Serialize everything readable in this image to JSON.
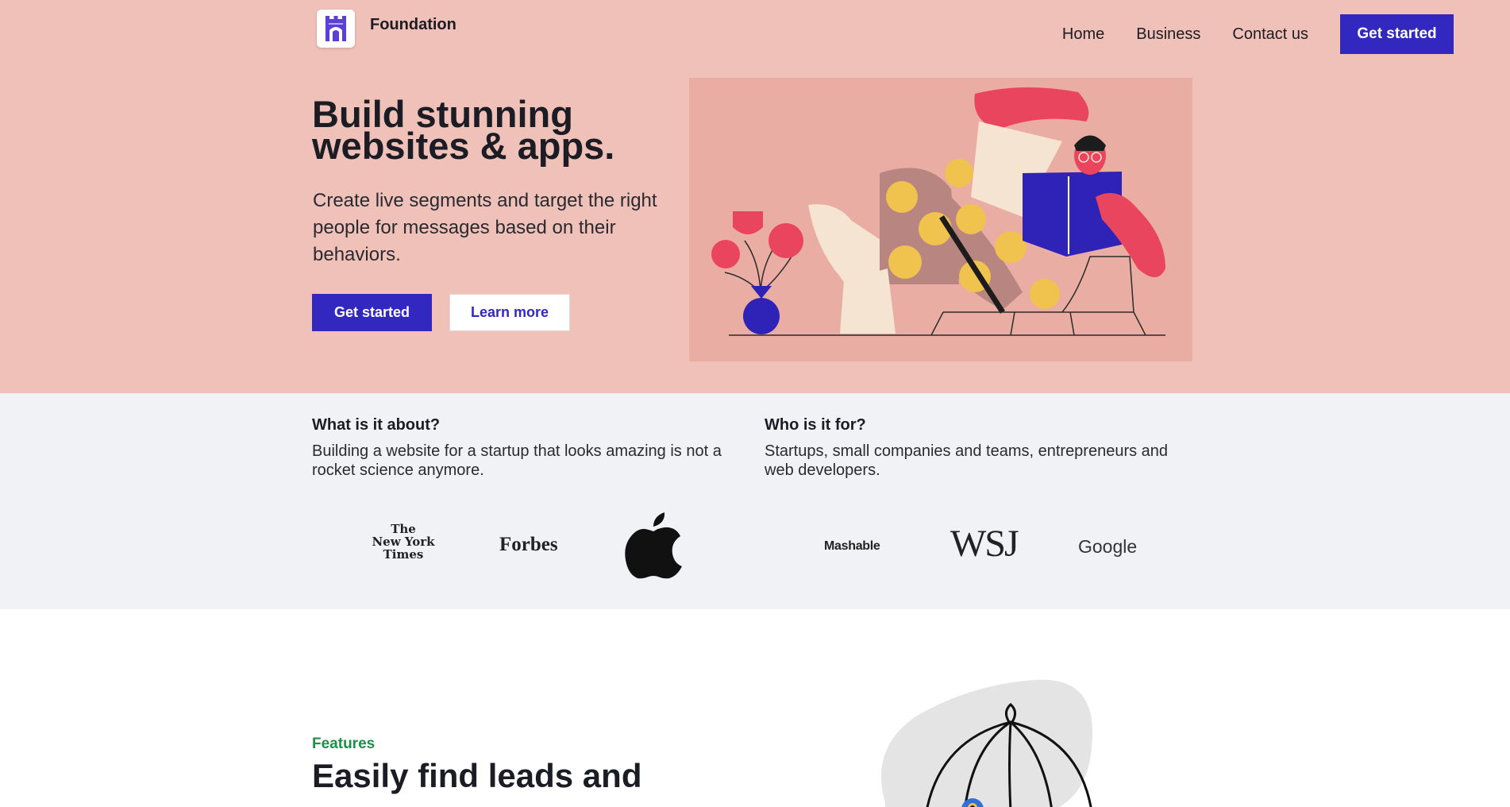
{
  "brand": {
    "name": "Foundation",
    "logo_icon": "castle-icon"
  },
  "nav": {
    "links": [
      "Home",
      "Business",
      "Contact us"
    ],
    "cta": "Get started"
  },
  "hero": {
    "title_line1": "Build stunning",
    "title_line2": "websites & apps.",
    "subtitle": "Create live segments and target the right people for messages based on their behaviors.",
    "primary_button": "Get started",
    "secondary_button": "Learn more",
    "background_color": "#f0c1b8",
    "accent_color": "#3228c0"
  },
  "about": {
    "left": {
      "heading": "What is it about?",
      "text": "Building a website for a startup that looks amazing is not a rocket science anymore."
    },
    "right": {
      "heading": "Who is it for?",
      "text": "Startups, small companies and teams, entrepreneurs and web developers."
    },
    "logos": [
      {
        "icon": "nyt-logo",
        "text_lines": [
          "The",
          "New York",
          "Times"
        ]
      },
      {
        "icon": "forbes-logo",
        "text": "Forbes"
      },
      {
        "icon": "apple-logo"
      },
      {
        "icon": "mashable-logo",
        "text": "Mashable"
      },
      {
        "icon": "wsj-logo",
        "text": "WSJ"
      },
      {
        "icon": "google-logo",
        "text": "Google"
      }
    ]
  },
  "features": {
    "eyebrow": "Features",
    "title": "Easily find leads and",
    "eyebrow_color": "#1a9147"
  }
}
